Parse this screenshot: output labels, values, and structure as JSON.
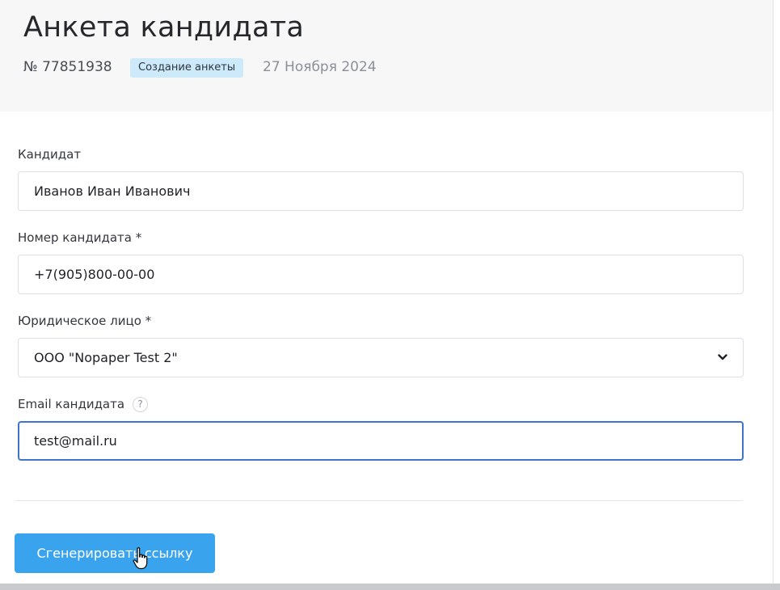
{
  "header": {
    "title": "Анкета кандидата",
    "number": "№ 77851938",
    "status_badge": "Создание анкеты",
    "date": "27 Ноября 2024"
  },
  "form": {
    "candidate": {
      "label": "Кандидат",
      "value": "Иванов Иван Иванович"
    },
    "phone": {
      "label": "Номер кандидата *",
      "value": "+7(905)800-00-00"
    },
    "legal_entity": {
      "label": "Юридическое лицо *",
      "value": "ООО \"Nopaper Test 2\""
    },
    "email": {
      "label": "Email кандидата",
      "help": "?",
      "value": "test@mail.ru"
    }
  },
  "actions": {
    "generate_label": "Сгенерировать ссылку"
  },
  "colors": {
    "header_bg": "#f7f7f8",
    "badge_bg": "#cdeafa",
    "focus_border": "#3f74c8",
    "primary_button": "#3aa3ee"
  },
  "icons": {
    "select_arrow": "chevron-down-icon",
    "help": "help-circle-icon",
    "cursor": "hand-cursor-icon"
  }
}
